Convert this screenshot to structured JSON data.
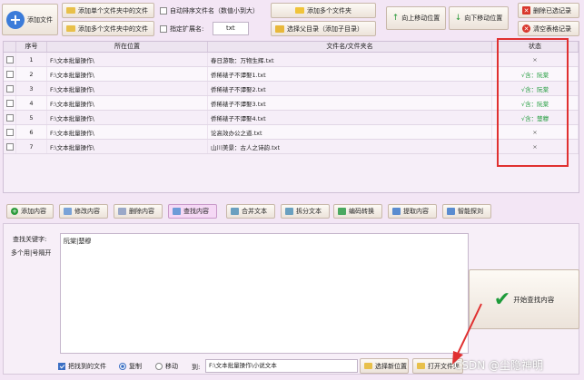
{
  "toolbar": {
    "add_file": "添加文件",
    "add_single_folder": "添加单个文件夹中的文件",
    "add_multi_folder": "添加多个文件夹中的文件",
    "auto_sort": "自动排序文件名（数值小到大）",
    "specify_ext": "指定扩展名:",
    "ext_value": "txt",
    "add_multi_dirs": "添加多个文件夹",
    "select_parent": "选择父目录（添加子目录）",
    "move_up": "向上移动位置",
    "move_down": "向下移动位置",
    "delete_selected": "删除已选记录",
    "clear_table": "清空表格记录"
  },
  "table": {
    "headers": [
      "序号",
      "所在位置",
      "文件名/文件夹名",
      "状态"
    ],
    "rows": [
      {
        "index": "1",
        "location": "F:\\文本批量操作\\",
        "name": "春日游歌：万物生辉.txt",
        "status": "×"
      },
      {
        "index": "2",
        "location": "F:\\文本批量操作\\",
        "name": "侨稀裱子不谭娶1.txt",
        "status": "√含：阮棠"
      },
      {
        "index": "3",
        "location": "F:\\文本批量操作\\",
        "name": "侨稀裱子不谭娶2.txt",
        "status": "√含：阮棠"
      },
      {
        "index": "4",
        "location": "F:\\文本批量操作\\",
        "name": "侨稀裱子不谭娶3.txt",
        "status": "√含：阮棠"
      },
      {
        "index": "5",
        "location": "F:\\文本批量操作\\",
        "name": "侨稀裱子不谭娶4.txt",
        "status": "√含：楚穆"
      },
      {
        "index": "6",
        "location": "F:\\文本批量操作\\",
        "name": "论高效办公之道.txt",
        "status": "×"
      },
      {
        "index": "7",
        "location": "F:\\文本批量操作\\",
        "name": "山川美景：古人之诗韵.txt",
        "status": "×"
      }
    ]
  },
  "tabs": [
    {
      "label": "添加内容"
    },
    {
      "label": "修改内容"
    },
    {
      "label": "删除内容"
    },
    {
      "label": "查找内容"
    },
    {
      "label": "合并文本"
    },
    {
      "label": "拆分文本"
    },
    {
      "label": "编码转换"
    },
    {
      "label": "提取内容"
    },
    {
      "label": "智能探刘"
    }
  ],
  "find": {
    "keyword_label": "查找关键字:",
    "hint": "多个用|号隔开",
    "keywords": "阮棠|楚穆",
    "start_button": "开始查找内容"
  },
  "bottom": {
    "move_found": "把找到的文件",
    "copy": "复制",
    "move": "移动",
    "to": "到:",
    "dest_path": "F:\\文本批量操作\\小说文本",
    "choose_location": "选择新位置",
    "open_folder": "打开文件夹"
  },
  "watermark": "CSDN @尘隐神明",
  "colors": {
    "accent_red": "#e03030",
    "check_green": "#1e9b3a",
    "selected_tab": "#f5d8f5"
  }
}
